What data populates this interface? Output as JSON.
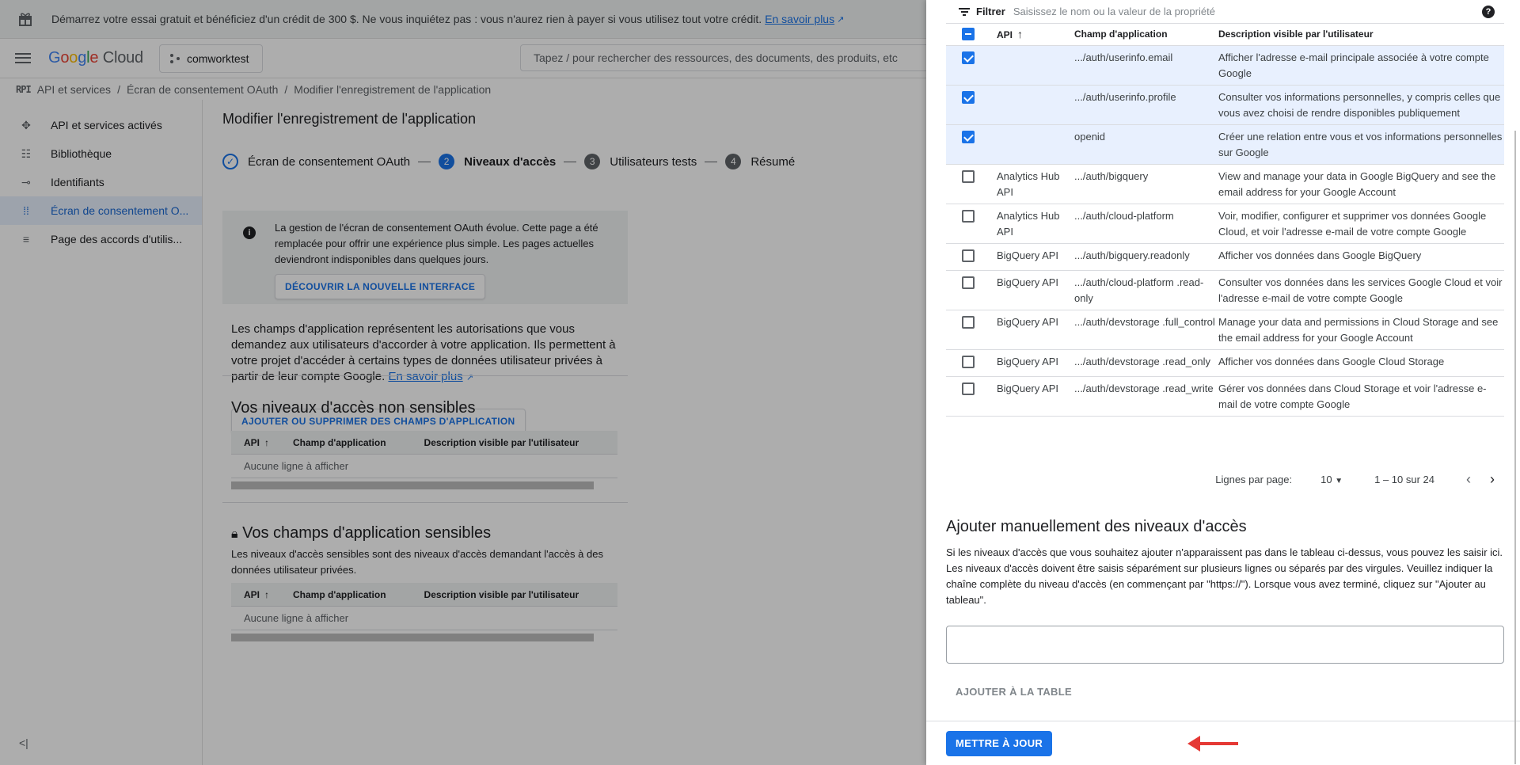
{
  "banner": {
    "text": "Démarrez votre essai gratuit et bénéficiez d'un crédit de 300 $. Ne vous inquiétez pas : vous n'aurez rien à payer si vous utilisez tout votre crédit.",
    "link": "En savoir plus"
  },
  "header": {
    "logo_google": [
      "G",
      "o",
      "o",
      "g",
      "l",
      "e"
    ],
    "logo_cloud": "Cloud",
    "project": "comworktest",
    "search_placeholder": "Tapez / pour rechercher des ressources, des documents, des produits, etc"
  },
  "breadcrumb": {
    "api_mark": "RPI",
    "items": [
      "API et services",
      "/",
      "Écran de consentement OAuth",
      "/",
      "Modifier l'enregistrement de l'application"
    ]
  },
  "sidebar": {
    "items": [
      {
        "label": "API et services activés",
        "icon": "api-icon"
      },
      {
        "label": "Bibliothèque",
        "icon": "library-icon"
      },
      {
        "label": "Identifiants",
        "icon": "key-icon"
      },
      {
        "label": "Écran de consentement O...",
        "icon": "consent-icon",
        "active": true
      },
      {
        "label": "Page des accords d'utilis...",
        "icon": "agreements-icon"
      }
    ],
    "collapse": "<|"
  },
  "main": {
    "title": "Modifier l'enregistrement de l'application",
    "steps": [
      {
        "num": "✓",
        "label": "Écran de consentement OAuth"
      },
      {
        "num": "2",
        "label": "Niveaux d'accès"
      },
      {
        "num": "3",
        "label": "Utilisateurs tests"
      },
      {
        "num": "4",
        "label": "Résumé"
      }
    ],
    "info": {
      "text": "La gestion de l'écran de consentement OAuth évolue. Cette page a été remplacée pour offrir une expérience plus simple. Les pages actuelles deviendront indisponibles dans quelques jours.",
      "button": "DÉCOUVRIR LA NOUVELLE INTERFACE"
    },
    "description": "Les champs d'application représentent les autorisations que vous demandez aux utilisateurs d'accorder à votre application. Ils permettent à votre projet d'accéder à certains types de données utilisateur privées à partir de leur compte Google.",
    "description_link": "En savoir plus",
    "add_fields_button": "AJOUTER OU SUPPRIMER DES CHAMPS D'APPLICATION",
    "non_sensitive": {
      "title": "Vos niveaux d'accès non sensibles",
      "headers": [
        "API",
        "Champ d'application",
        "Description visible par l'utilisateur"
      ],
      "empty": "Aucune ligne à afficher"
    },
    "sensitive": {
      "title": "Vos champs d'application sensibles",
      "description": "Les niveaux d'accès sensibles sont des niveaux d'accès demandant l'accès à des données utilisateur privées.",
      "headers": [
        "API",
        "Champ d'application",
        "Description visible par l'utilisateur"
      ],
      "empty": "Aucune ligne à afficher"
    }
  },
  "panel": {
    "filter_label": "Filtrer",
    "filter_placeholder": "Saisissez le nom ou la valeur de la propriété",
    "headers": {
      "api": "API",
      "scope": "Champ d'application",
      "description": "Description visible par l'utilisateur"
    },
    "rows": [
      {
        "checked": true,
        "api": "",
        "scope": ".../auth/userinfo.email",
        "description": "Afficher l'adresse e-mail principale associée à votre compte Google"
      },
      {
        "checked": true,
        "api": "",
        "scope": ".../auth/userinfo.profile",
        "description": "Consulter vos informations personnelles, y compris celles que vous avez choisi de rendre disponibles publiquement"
      },
      {
        "checked": true,
        "api": "",
        "scope": "openid",
        "description": "Créer une relation entre vous et vos informations personnelles sur Google"
      },
      {
        "checked": false,
        "api": "Analytics Hub API",
        "scope": ".../auth/bigquery",
        "description": "View and manage your data in Google BigQuery and see the email address for your Google Account"
      },
      {
        "checked": false,
        "api": "Analytics Hub API",
        "scope": ".../auth/cloud-platform",
        "description": "Voir, modifier, configurer et supprimer vos données Google Cloud, et voir l'adresse e-mail de votre compte Google"
      },
      {
        "checked": false,
        "api": "BigQuery API",
        "scope": ".../auth/bigquery.readonly",
        "description": "Afficher vos données dans Google BigQuery"
      },
      {
        "checked": false,
        "api": "BigQuery API",
        "scope": ".../auth/cloud-platform .read-only",
        "description": "Consulter vos données dans les services Google Cloud et voir l'adresse e-mail de votre compte Google"
      },
      {
        "checked": false,
        "api": "BigQuery API",
        "scope": ".../auth/devstorage .full_control",
        "description": "Manage your data and permissions in Cloud Storage and see the email address for your Google Account"
      },
      {
        "checked": false,
        "api": "BigQuery API",
        "scope": ".../auth/devstorage .read_only",
        "description": "Afficher vos données dans Google Cloud Storage"
      },
      {
        "checked": false,
        "api": "BigQuery API",
        "scope": ".../auth/devstorage .read_write",
        "description": "Gérer vos données dans Cloud Storage et voir l'adresse e-mail de votre compte Google"
      }
    ],
    "pager": {
      "rows_label": "Lignes par page:",
      "rows_value": "10",
      "range": "1 – 10 sur 24"
    },
    "manual": {
      "title": "Ajouter manuellement des niveaux d'accès",
      "description": "Si les niveaux d'accès que vous souhaitez ajouter n'apparaissent pas dans le tableau ci-dessus, vous pouvez les saisir ici. Les niveaux d'accès doivent être saisis séparément sur plusieurs lignes ou séparés par des virgules. Veuillez indiquer la chaîne complète du niveau d'accès (en commençant par \"https://\"). Lorsque vous avez terminé, cliquez sur \"Ajouter au tableau\".",
      "add_button": "AJOUTER À LA TABLE"
    },
    "update_button": "METTRE À JOUR"
  },
  "colors": {
    "accent": "#1a73e8",
    "arrow": "#e53935"
  }
}
